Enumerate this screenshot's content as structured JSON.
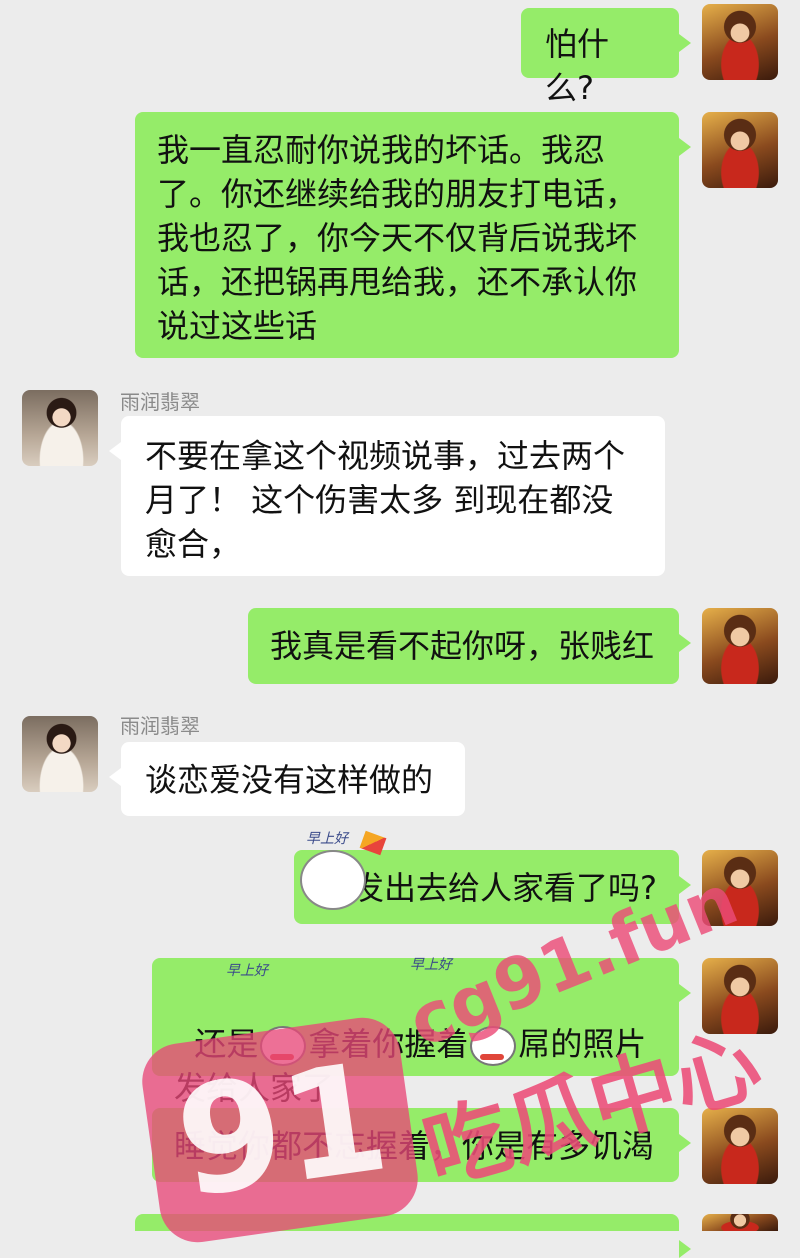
{
  "contact": {
    "name": "雨润翡翠"
  },
  "messages": [
    {
      "from": "me",
      "text": "怕什么?"
    },
    {
      "from": "me",
      "text": "我一直忍耐你说我的坏话。我忍了。你还继续给我的朋友打电话，我也忍了，你今天不仅背后说我坏话，还把锅再甩给我，还不承认你说过这些话"
    },
    {
      "from": "other",
      "sender": "雨润翡翠",
      "text": "不要在拿这个视频说事，过去两个月了！ 这个伤害太多 到现在都没愈合，"
    },
    {
      "from": "me",
      "text": "我真是看不起你呀，张贱红"
    },
    {
      "from": "other",
      "sender": "雨润翡翠",
      "text": "谈恋爱没有这样做的"
    },
    {
      "from": "me",
      "text": "发出去给人家看了吗?"
    },
    {
      "from": "me",
      "text_a": "还是",
      "text_b": "拿着你握着",
      "text_c": "屌的照片发给人家了"
    },
    {
      "from": "me",
      "text": "睡觉你都不忘握着，你是有多饥渴"
    }
  ],
  "stickers": {
    "label": "早上好"
  },
  "watermark": {
    "badge": "91",
    "url": "cg91.fun",
    "cn": "吃瓜中心"
  }
}
